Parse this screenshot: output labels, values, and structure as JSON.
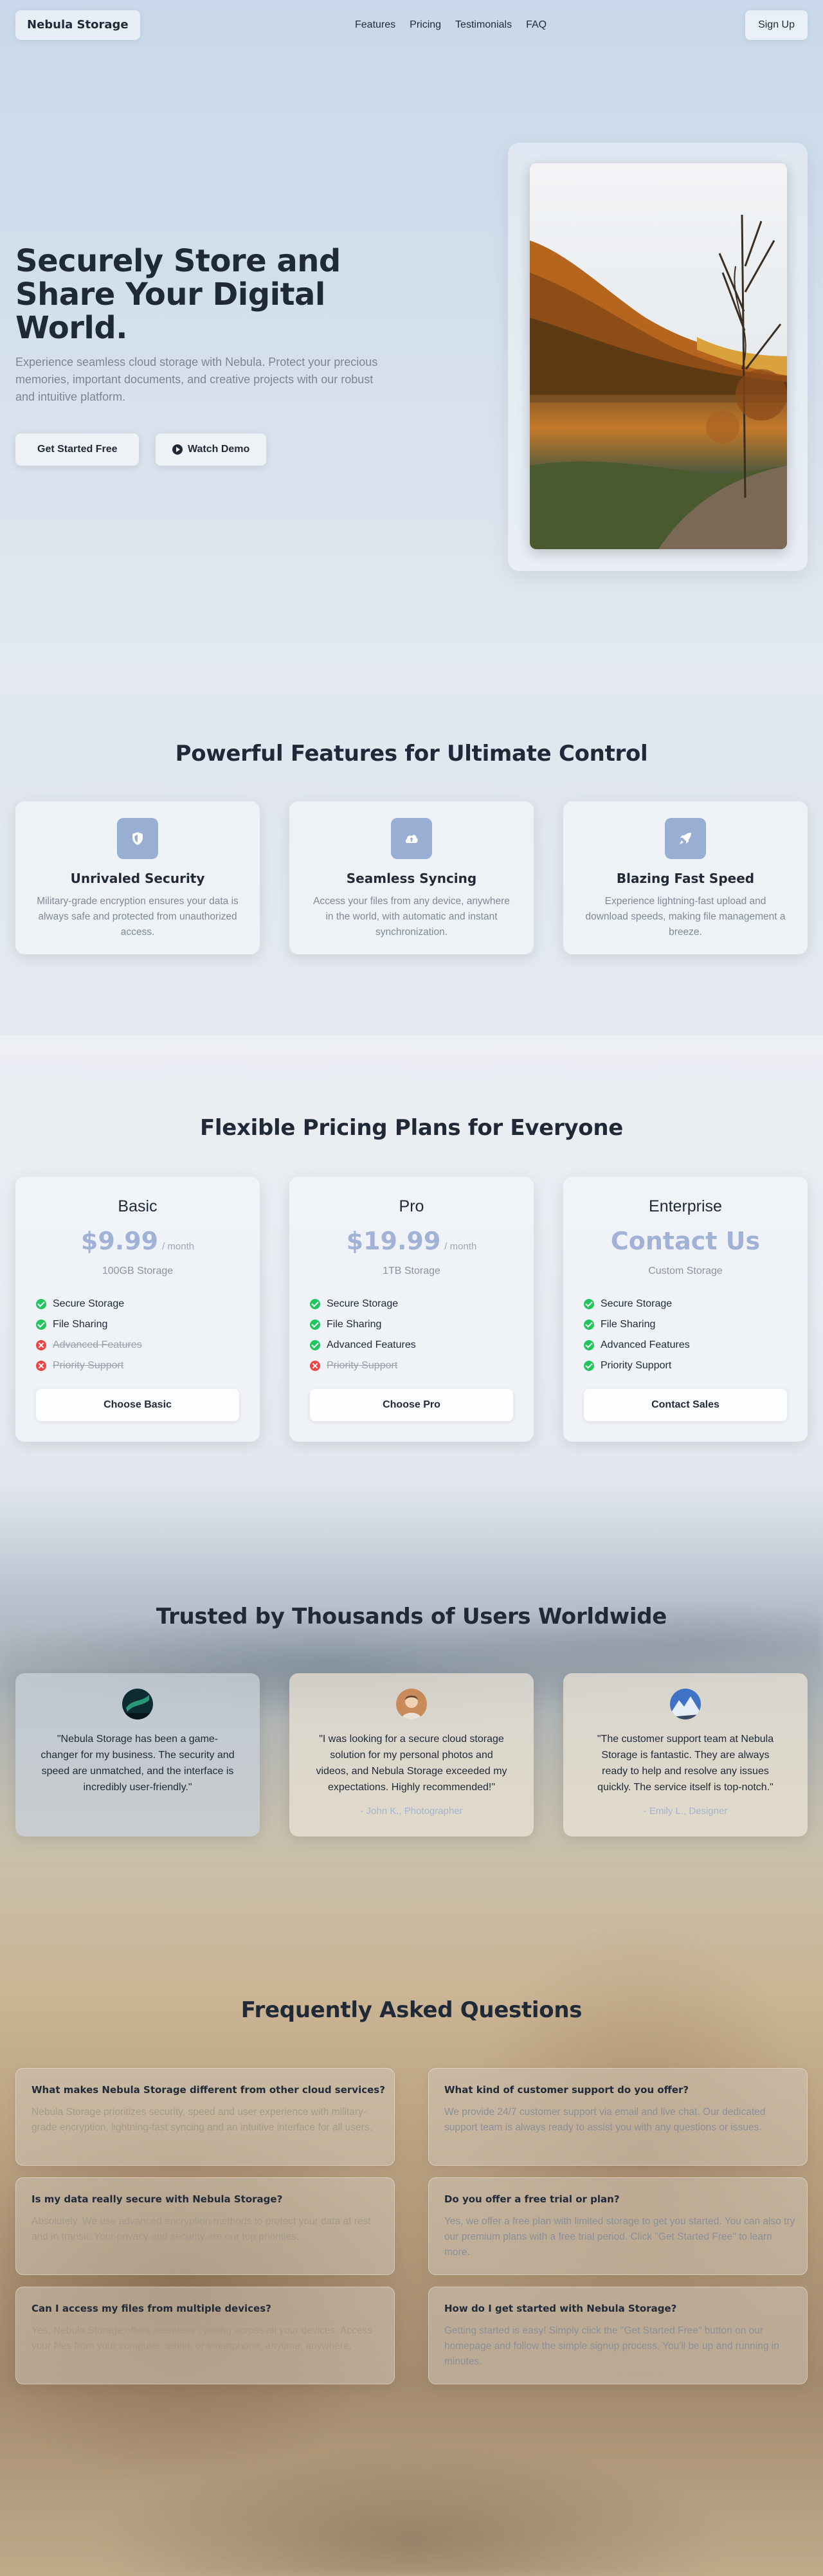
{
  "nav": {
    "logo": "Nebula Storage",
    "links": [
      "Features",
      "Pricing",
      "Testimonials",
      "FAQ"
    ],
    "signup": "Sign Up"
  },
  "hero": {
    "title": "Securely Store and Share Your Digital World.",
    "text": "Experience seamless cloud storage with Nebula. Protect your precious memories, important documents, and creative projects with our robust and intuitive platform.",
    "primary_button": "Get Started Free",
    "secondary_button": "Watch Demo",
    "image_icon": "autumn-lake-photo"
  },
  "features": {
    "title": "Powerful Features for Ultimate Control",
    "items": [
      {
        "icon": "shield-icon",
        "title": "Unrivaled Security",
        "desc": "Military-grade encryption ensures your data is always safe and protected from unauthorized access."
      },
      {
        "icon": "cloud-upload-icon",
        "title": "Seamless Syncing",
        "desc": "Access your files from any device, anywhere in the world, with automatic and instant synchronization."
      },
      {
        "icon": "rocket-icon",
        "title": "Blazing Fast Speed",
        "desc": "Experience lightning-fast upload and download speeds, making file management a breeze."
      }
    ]
  },
  "pricing": {
    "title": "Flexible Pricing Plans for Everyone",
    "plans": [
      {
        "name": "Basic",
        "price": "$9.99",
        "period": "/ month",
        "storage": "100GB Storage",
        "features": [
          {
            "label": "Secure Storage",
            "included": true
          },
          {
            "label": "File Sharing",
            "included": true
          },
          {
            "label": "Advanced Features",
            "included": false
          },
          {
            "label": "Priority Support",
            "included": false
          }
        ],
        "button": "Choose Basic"
      },
      {
        "name": "Pro",
        "price": "$19.99",
        "period": "/ month",
        "storage": "1TB Storage",
        "features": [
          {
            "label": "Secure Storage",
            "included": true
          },
          {
            "label": "File Sharing",
            "included": true
          },
          {
            "label": "Advanced Features",
            "included": true
          },
          {
            "label": "Priority Support",
            "included": false
          }
        ],
        "button": "Choose Pro"
      },
      {
        "name": "Enterprise",
        "price": "Contact Us",
        "period": "",
        "storage": "Custom Storage",
        "features": [
          {
            "label": "Secure Storage",
            "included": true
          },
          {
            "label": "File Sharing",
            "included": true
          },
          {
            "label": "Advanced Features",
            "included": true
          },
          {
            "label": "Priority Support",
            "included": true
          }
        ],
        "button": "Contact Sales"
      }
    ]
  },
  "testimonials": {
    "title": "Trusted by Thousands of Users Worldwide",
    "items": [
      {
        "avatar": "aurora-avatar",
        "quote": "\"Nebula Storage has been a game-changer for my business. The security and speed are unmatched, and the interface is incredibly user-friendly.\"",
        "author": ""
      },
      {
        "avatar": "portrait-avatar",
        "quote": "\"I was looking for a secure cloud storage solution for my personal photos and videos, and Nebula Storage exceeded my expectations. Highly recommended!\"",
        "author": "- John K., Photographer"
      },
      {
        "avatar": "mountain-avatar",
        "quote": "\"The customer support team at Nebula Storage is fantastic. They are always ready to help and resolve any issues quickly. The service itself is top-notch.\"",
        "author": "- Emily L., Designer"
      }
    ]
  },
  "faq": {
    "title": "Frequently Asked Questions",
    "items": [
      {
        "q": "What makes Nebula Storage different from other cloud services?",
        "a": "Nebula Storage prioritizes security, speed and user experience with military-grade encryption, lightning-fast syncing and an intuitive interface for all users."
      },
      {
        "q": "What kind of customer support do you offer?",
        "a": "We provide 24/7 customer support via email and live chat. Our dedicated support team is always ready to assist you with any questions or issues."
      },
      {
        "q": "Is my data really secure with Nebula Storage?",
        "a": "Absolutely. We use advanced encryption methods to protect your data at rest and in transit. Your privacy and security are our top priorities."
      },
      {
        "q": "Do you offer a free trial or plan?",
        "a": "Yes, we offer a free plan with limited storage to get you started. You can also try our premium plans with a free trial period. Click \"Get Started Free\" to learn more."
      },
      {
        "q": "Can I access my files from multiple devices?",
        "a": "Yes, Nebula Storage offers seamless syncing across all your devices. Access your files from your computer, tablet, or smartphone, anytime, anywhere."
      },
      {
        "q": "How do I get started with Nebula Storage?",
        "a": "Getting started is easy! Simply click the \"Get Started Free\" button on our homepage and follow the simple signup process. You'll be up and running in minutes."
      }
    ]
  }
}
